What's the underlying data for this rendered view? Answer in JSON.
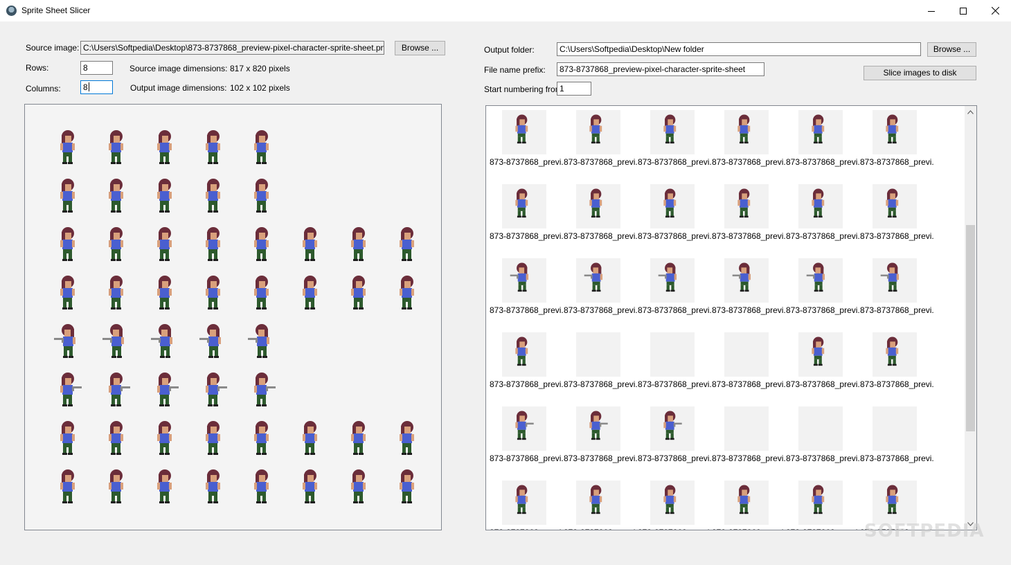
{
  "window": {
    "title": "Sprite Sheet Slicer",
    "controls": {
      "minimize": "minimize-icon",
      "maximize": "maximize-icon",
      "close": "close-icon"
    }
  },
  "source": {
    "image_label": "Source image:",
    "image_path": "C:\\Users\\Softpedia\\Desktop\\873-8737868_preview-pixel-character-sprite-sheet.png",
    "browse_label": "Browse ...",
    "rows_label": "Rows:",
    "rows_value": "8",
    "columns_label": "Columns:",
    "columns_value": "8",
    "src_dim_label": "Source image dimensions:",
    "src_dim_value": "817 x 820 pixels",
    "out_dim_label": "Output image dimensions:",
    "out_dim_value": "102 x 102 pixels"
  },
  "output": {
    "folder_label": "Output folder:",
    "folder_value": "C:\\Users\\Softpedia\\Desktop\\New folder",
    "browse_label": "Browse ...",
    "prefix_label": "File name prefix:",
    "prefix_value": "873-8737868_preview-pixel-character-sprite-sheet",
    "start_label": "Start numbering from:",
    "start_value": "1",
    "slice_label": "Slice images to disk"
  },
  "sheet_rows": [
    5,
    5,
    8,
    8,
    5,
    5,
    8,
    8
  ],
  "tile_caption": "873-8737868_previ...",
  "tiles_visible_rows": [
    [
      true,
      true,
      true,
      true,
      true,
      true
    ],
    [
      true,
      true,
      true,
      true,
      true,
      true
    ],
    [
      true,
      true,
      true,
      true,
      true,
      true
    ],
    [
      true,
      false,
      false,
      false,
      true,
      true
    ],
    [
      true,
      true,
      true,
      false,
      false,
      false
    ],
    [
      true,
      true,
      true,
      true,
      true,
      true
    ]
  ],
  "colors": {
    "hair": "#6b2d3a",
    "skin": "#d9a07c",
    "shirt": "#4a5fd0",
    "pants": "#2d5a2d",
    "gun": "#8a8a8a"
  },
  "watermark": "SOFTPEDIA"
}
